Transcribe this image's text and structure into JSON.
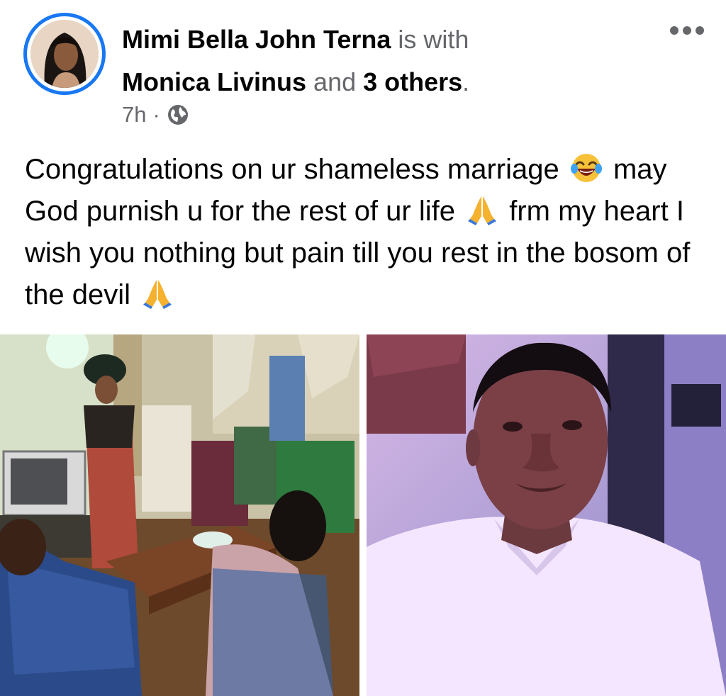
{
  "post": {
    "author_name": "Mimi Bella John Terna",
    "with_text": " is with ",
    "tagged_name": "Monica Livinus",
    "and_text": " and ",
    "others_text": "3 others",
    "period": ".",
    "time_ago": "7h",
    "separator": "·",
    "audience_icon": "globe-icon",
    "menu_icon": "more-options-icon",
    "body_segments": [
      "Congratulations on ur shameless marriage",
      "may God purnish u for the rest of ur life",
      "frm my heart I wish you nothing but pain till you rest in the bosom of the devil"
    ],
    "emojis": [
      "face-with-tears-of-joy-emoji",
      "folded-hands-emoji",
      "folded-hands-emoji"
    ]
  },
  "photos": [
    {
      "name": "wedding-gathering-photo"
    },
    {
      "name": "man-selfie-photo"
    }
  ],
  "colors": {
    "accent": "#1877f2",
    "secondary_text": "#65676b",
    "primary_text": "#050505"
  }
}
